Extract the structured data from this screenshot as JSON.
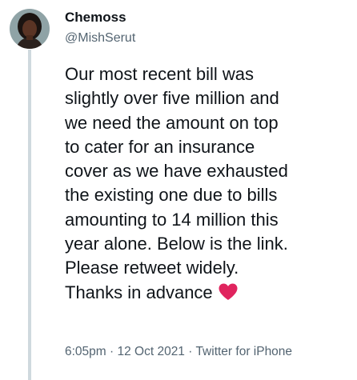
{
  "author": {
    "display_name": "Chemoss",
    "handle": "@MishSerut"
  },
  "tweet": {
    "lines": [
      "Our most recent bill was",
      "slightly over five million and",
      "we need the amount on top",
      "to cater for an insurance",
      "cover as we have exhausted",
      "the existing one due to bills",
      "amounting to 14 million this",
      "year alone. Below is the link.",
      "Please retweet widely.",
      "Thanks in advance"
    ],
    "emoji": "heart-icon",
    "emoji_color": "#e0245e"
  },
  "meta": {
    "time": "6:05pm",
    "separator": " · ",
    "date": "12 Oct 2021",
    "source": "Twitter for iPhone"
  }
}
